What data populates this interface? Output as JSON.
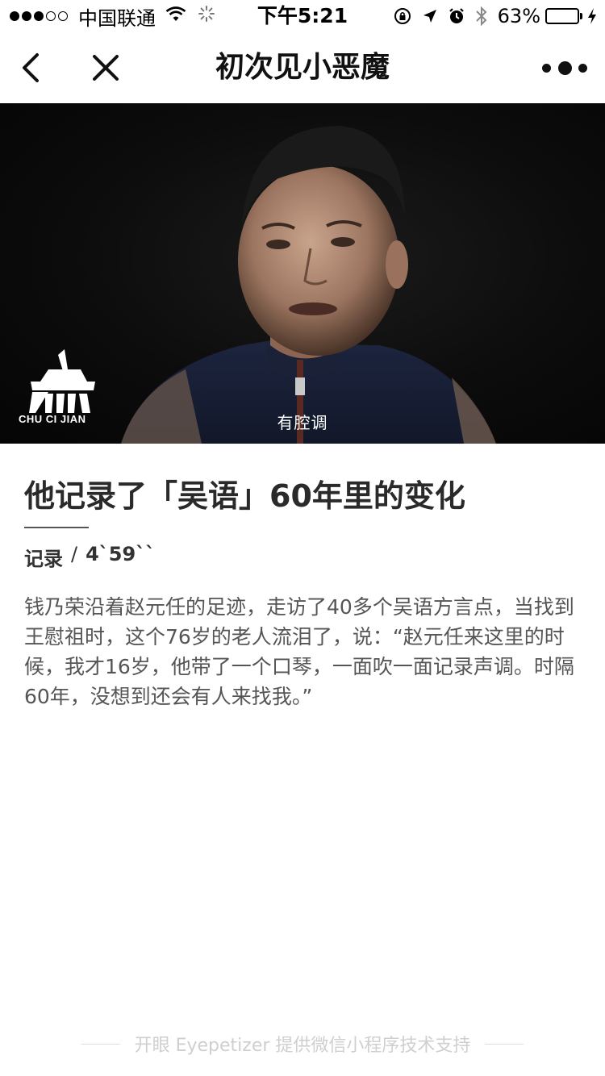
{
  "status_bar": {
    "carrier": "中国联通",
    "time": "下午5:21",
    "battery_percent": "63%",
    "battery_level": 0.63,
    "signal_strength": 3,
    "signal_total": 5,
    "battery_color": "#4cd964"
  },
  "nav": {
    "title": "初次见小恶魔",
    "back_icon": "chevron-left-icon",
    "close_icon": "close-icon",
    "more_icon": "more-dots-icon"
  },
  "video": {
    "logo_text": "CHU CI JIAN",
    "subtitle": "有腔调"
  },
  "article": {
    "title": "他记录了「吴语」60年里的变化",
    "category": "记录",
    "separator": "/",
    "duration": "4`59``",
    "description": "钱乃荣沿着赵元任的足迹，走访了40多个吴语方言点，当找到王慰祖时，这个76岁的老人流泪了，说：“赵元任来这里的时候，我才16岁，他带了一个口琴，一面吹一面记录声调。时隔60年，没想到还会有人来找我。”"
  },
  "footer": {
    "text": "开眼 Eyepetizer 提供微信小程序技术支持"
  }
}
